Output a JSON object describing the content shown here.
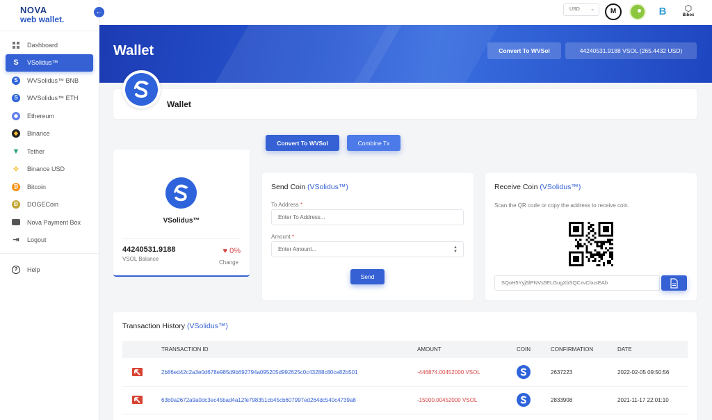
{
  "app": {
    "logo_line1": "NOVA",
    "logo_line2": "web wallet."
  },
  "sidebar": {
    "items": [
      {
        "label": "Dashboard",
        "icon": "dashboard-icon"
      },
      {
        "label": "VSolidus™",
        "icon": "vsolidus-icon"
      },
      {
        "label": "WVSolidus™ BNB",
        "icon": "vsolidus-icon"
      },
      {
        "label": "WVSolidus™ ETH",
        "icon": "vsolidus-icon"
      },
      {
        "label": "Ethereum",
        "icon": "ethereum-icon"
      },
      {
        "label": "Binance",
        "icon": "binance-icon"
      },
      {
        "label": "Tether",
        "icon": "tether-icon"
      },
      {
        "label": "Binance USD",
        "icon": "binance-usd-icon"
      },
      {
        "label": "Bitcoin",
        "icon": "bitcoin-icon"
      },
      {
        "label": "DOGECoin",
        "icon": "dogecoin-icon"
      },
      {
        "label": "Nova Payment Box",
        "icon": "wallet-icon"
      },
      {
        "label": "Logout",
        "icon": "logout-icon"
      }
    ],
    "help_label": "Help"
  },
  "topbar": {
    "currency": "USD"
  },
  "banner": {
    "title": "Wallet",
    "convert_label": "Convert To WVSol",
    "balance_label": "44240531.9188 VSOL (265.4432 USD)"
  },
  "wallet_card": {
    "name": "Wallet"
  },
  "actions": {
    "convert_label": "Convert To WVSol",
    "combine_label": "Combine Tx"
  },
  "balance": {
    "coin_name": "VSolidus™",
    "amount": "44240531.9188",
    "label": "VSOL Balance",
    "change": "0%",
    "change_label": "Change"
  },
  "send": {
    "title": "Send Coin",
    "coin": "(VSolidus™)",
    "to_label": "To Address",
    "to_placeholder": "Enter To Address...",
    "amount_label": "Amount",
    "amount_placeholder": "Enter Amount...",
    "send_label": "Send"
  },
  "receive": {
    "title": "Receive Coin",
    "coin": "(VSolidus™)",
    "description": "Scan the QR code or copy the address to receive coin.",
    "address": "SQoH5YyjSlPNVs5ELGugXbSQCzvCbusEAb"
  },
  "transactions": {
    "title": "Transaction History",
    "coin": "(VSolidus™)",
    "columns": [
      "TRANSACTION ID",
      "AMOUNT",
      "COIN",
      "CONFIRMATION",
      "DATE"
    ],
    "rows": [
      {
        "id": "2b86ed42c2a3e0d678e985d9b692794a095205d992625c0c43288c80ce82b501",
        "amount": "-446874.00452000 VSOL",
        "confirmation": "2637223",
        "date": "2022-02-05 09:50:56"
      },
      {
        "id": "63b0a2672a9a0dc3ec45bad4a12fe798351cb45cb607997ed264dc540c4739a8",
        "amount": "-15000.00452000 VSOL",
        "confirmation": "2833908",
        "date": "2021-11-17 22:01:10"
      }
    ]
  },
  "colors": {
    "accent": "#3561d4",
    "negative": "#d64545",
    "banner": "#2756d0"
  }
}
